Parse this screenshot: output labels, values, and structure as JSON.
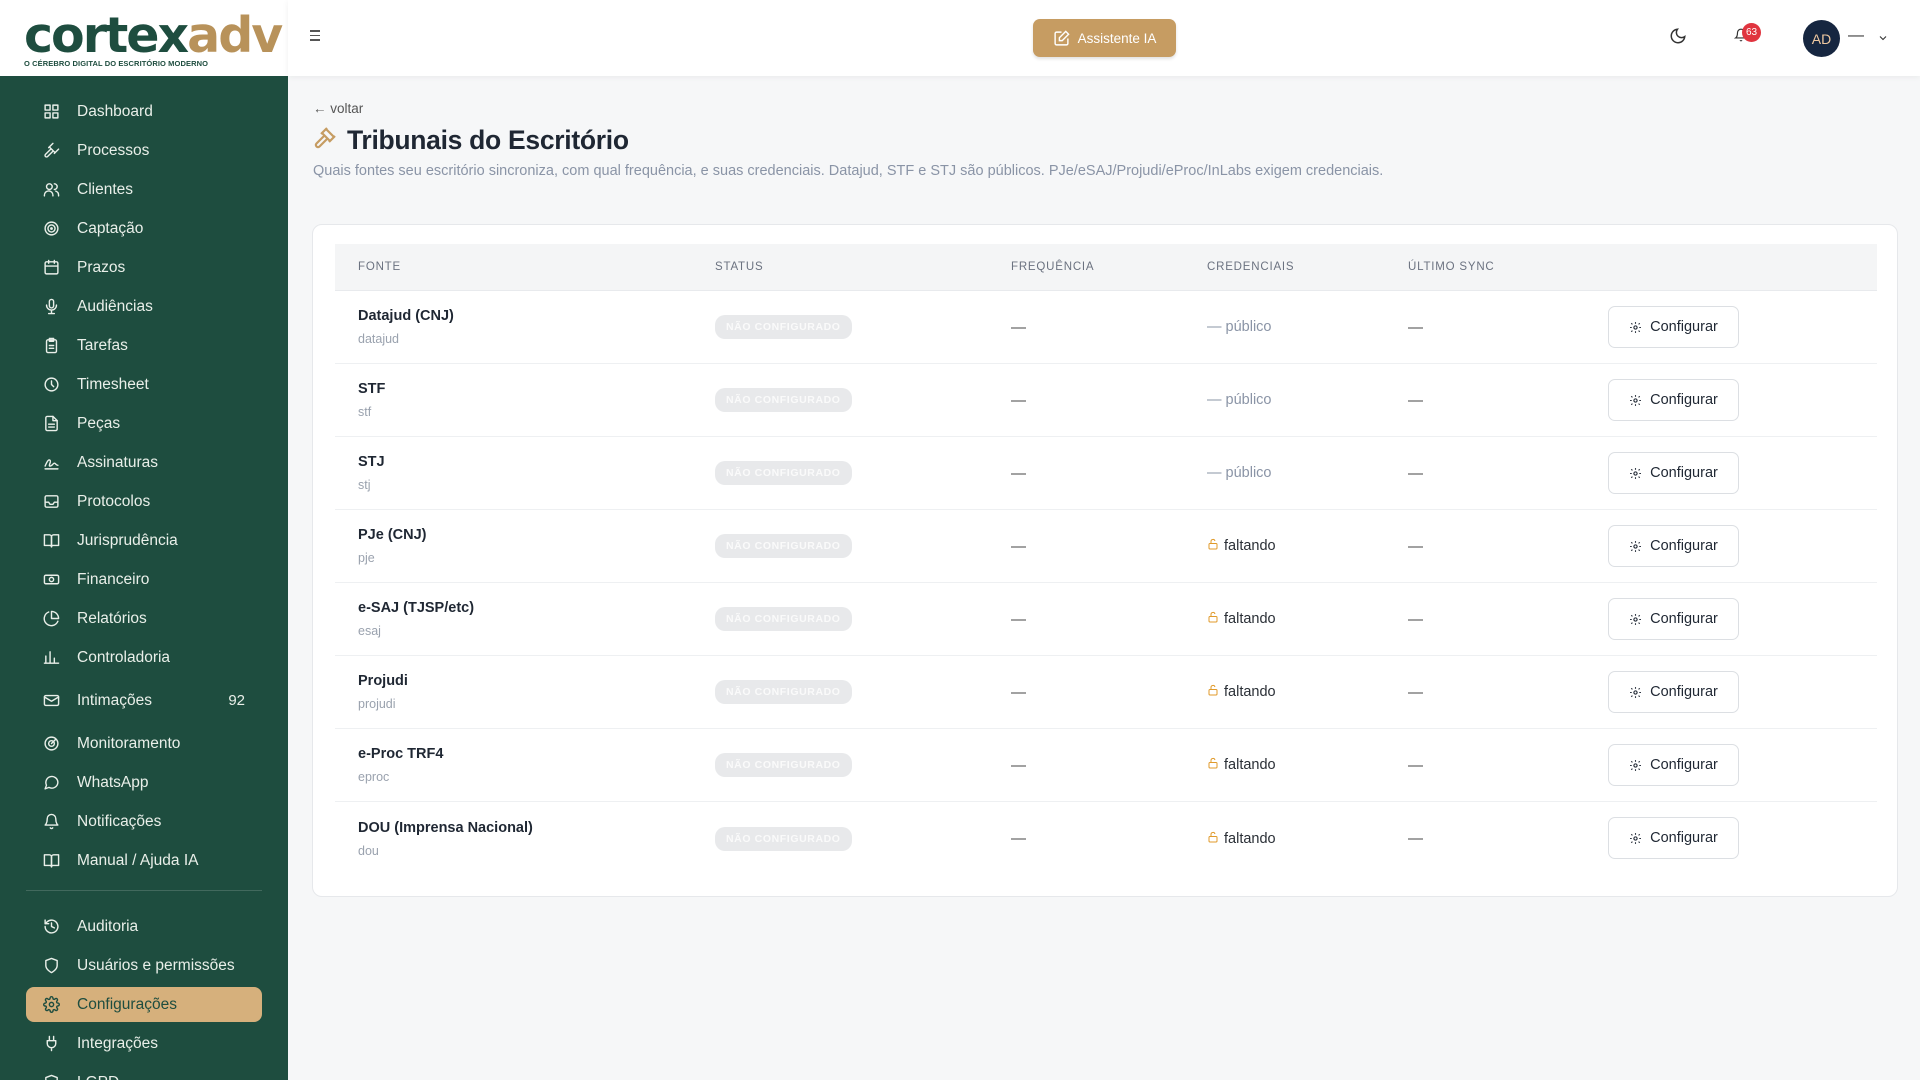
{
  "brand": {
    "name_main": "c",
    "name_o": "o",
    "name_rest": "rtex",
    "name_accent": "adv",
    "tagline": "O CÉREBRO DIGITAL DO ESCRITÓRIO MODERNO"
  },
  "sidebar": {
    "items": [
      {
        "label": "Dashboard",
        "icon": "dashboard-icon"
      },
      {
        "label": "Processos",
        "icon": "gavel-icon"
      },
      {
        "label": "Clientes",
        "icon": "users-icon"
      },
      {
        "label": "Captação",
        "icon": "target-icon"
      },
      {
        "label": "Prazos",
        "icon": "calendar-icon"
      },
      {
        "label": "Audiências",
        "icon": "microphone-icon"
      },
      {
        "label": "Tarefas",
        "icon": "clipboard-icon"
      },
      {
        "label": "Timesheet",
        "icon": "clock-icon"
      },
      {
        "label": "Peças",
        "icon": "document-icon"
      },
      {
        "label": "Assinaturas",
        "icon": "signature-icon"
      },
      {
        "label": "Protocolos",
        "icon": "inbox-icon"
      },
      {
        "label": "Jurisprudência",
        "icon": "book-icon"
      },
      {
        "label": "Financeiro",
        "icon": "money-icon"
      },
      {
        "label": "Relatórios",
        "icon": "pie-chart-icon"
      },
      {
        "label": "Controladoria",
        "icon": "bar-chart-icon"
      },
      {
        "label": "Intimações",
        "icon": "mail-icon",
        "badge": "92"
      },
      {
        "label": "Monitoramento",
        "icon": "radar-icon"
      },
      {
        "label": "WhatsApp",
        "icon": "whatsapp-icon"
      },
      {
        "label": "Notificações",
        "icon": "bell-icon"
      },
      {
        "label": "Manual / Ajuda IA",
        "icon": "book-open-icon"
      }
    ],
    "admin_items": [
      {
        "label": "Auditoria",
        "icon": "history-icon"
      },
      {
        "label": "Usuários e permissões",
        "icon": "shield-icon"
      },
      {
        "label": "Configurações",
        "icon": "settings-icon",
        "active": true
      },
      {
        "label": "Integrações",
        "icon": "plug-icon"
      },
      {
        "label": "LGPD",
        "icon": "shield-check-icon"
      }
    ]
  },
  "header": {
    "ai_button": "Assistente IA",
    "notifications_count": "63",
    "avatar_initials": "AD",
    "user_name": "—"
  },
  "page": {
    "back": "← voltar",
    "title": "Tribunais do Escritório",
    "subtitle": "Quais fontes seu escritório sincroniza, com qual frequência, e suas credenciais. Datajud, STF e STJ são públicos. PJe/eSAJ/Projudi/eProc/InLabs exigem credenciais."
  },
  "table": {
    "headers": [
      "FONTE",
      "STATUS",
      "FREQUÊNCIA",
      "CREDENCIAIS",
      "ÚLTIMO SYNC",
      ""
    ],
    "rows": [
      {
        "name": "Datajud (CNJ)",
        "code": "datajud",
        "status": "NÃO CONFIGURADO",
        "frequency": "—",
        "credentials": "— público",
        "cred_type": "public",
        "last_sync": "—",
        "action": "Configurar"
      },
      {
        "name": "STF",
        "code": "stf",
        "status": "NÃO CONFIGURADO",
        "frequency": "—",
        "credentials": "— público",
        "cred_type": "public",
        "last_sync": "—",
        "action": "Configurar"
      },
      {
        "name": "STJ",
        "code": "stj",
        "status": "NÃO CONFIGURADO",
        "frequency": "—",
        "credentials": "— público",
        "cred_type": "public",
        "last_sync": "—",
        "action": "Configurar"
      },
      {
        "name": "PJe (CNJ)",
        "code": "pje",
        "status": "NÃO CONFIGURADO",
        "frequency": "—",
        "credentials": "faltando",
        "cred_type": "missing",
        "last_sync": "—",
        "action": "Configurar"
      },
      {
        "name": "e-SAJ (TJSP/etc)",
        "code": "esaj",
        "status": "NÃO CONFIGURADO",
        "frequency": "—",
        "credentials": "faltando",
        "cred_type": "missing",
        "last_sync": "—",
        "action": "Configurar"
      },
      {
        "name": "Projudi",
        "code": "projudi",
        "status": "NÃO CONFIGURADO",
        "frequency": "—",
        "credentials": "faltando",
        "cred_type": "missing",
        "last_sync": "—",
        "action": "Configurar"
      },
      {
        "name": "e-Proc TRF4",
        "code": "eproc",
        "status": "NÃO CONFIGURADO",
        "frequency": "—",
        "credentials": "faltando",
        "cred_type": "missing",
        "last_sync": "—",
        "action": "Configurar"
      },
      {
        "name": "DOU (Imprensa Nacional)",
        "code": "dou",
        "status": "NÃO CONFIGURADO",
        "frequency": "—",
        "credentials": "faltando",
        "cred_type": "missing",
        "last_sync": "—",
        "action": "Configurar"
      }
    ]
  },
  "colors": {
    "sidebar_bg": "#1e4d3f",
    "accent_gold": "#c69c62",
    "active_item": "#d6b07c",
    "badge_red": "#e0343f"
  }
}
